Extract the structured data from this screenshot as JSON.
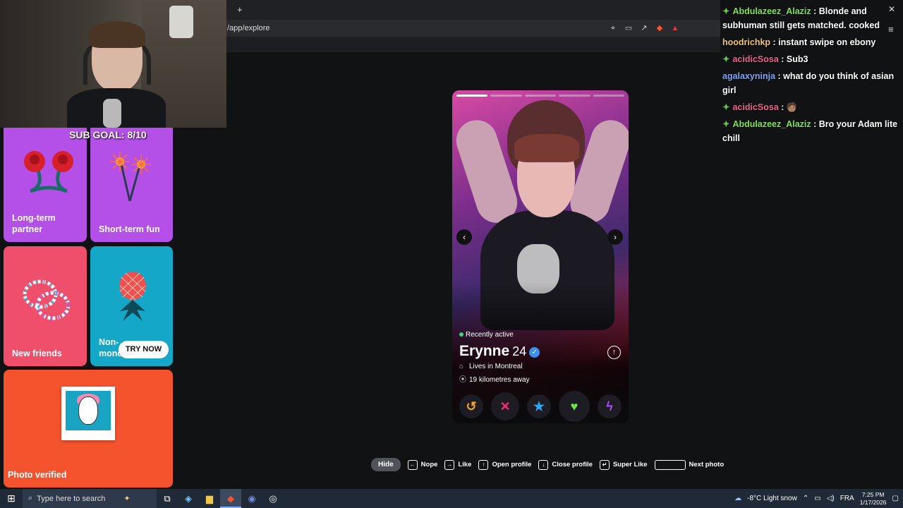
{
  "browser": {
    "new_tab_icon": "+",
    "url": "/app/explore"
  },
  "left_panel": {
    "sub_goal": "SUB GOAL: 8/10",
    "tiles": [
      {
        "label": "Long-term partner",
        "icon": "roses-icon",
        "color": "#b450e8"
      },
      {
        "label": "Short-term fun",
        "icon": "sparkler-icon",
        "color": "#b450e8"
      },
      {
        "label": "New friends",
        "icon": "bracelet-icon",
        "color": "#ef4f6b"
      },
      {
        "label": "Non-monogamous",
        "icon": "pineapple-icon",
        "color": "#14a7c7"
      },
      {
        "label": "Photo verified",
        "icon": "photo-card-icon",
        "color": "#f4532d"
      }
    ],
    "try_now": "TRY NOW"
  },
  "profile": {
    "status": "Recently active",
    "name": "Erynne",
    "age": "24",
    "lives_in": "Lives in Montreal",
    "distance": "19 kilometres away",
    "photo_count": 5,
    "active_photo_index": 0
  },
  "shortcuts": {
    "hide": "Hide",
    "items": [
      {
        "label": "Nope",
        "key": "←"
      },
      {
        "label": "Like",
        "key": "→"
      },
      {
        "label": "Open profile",
        "key": "↑"
      },
      {
        "label": "Close profile",
        "key": "↓"
      },
      {
        "label": "Super Like",
        "key": "↵"
      },
      {
        "label": "Next photo",
        "key": ""
      }
    ]
  },
  "chat": {
    "messages": [
      {
        "user": "Abdulazeez_Alaziz",
        "color": "#7ee64a",
        "badge": true,
        "text": "Blonde and subhuman still gets matched. cooked"
      },
      {
        "user": "hoodrichkp",
        "color": "#f4c56a",
        "badge": false,
        "text": "instant swipe on ebony"
      },
      {
        "user": "acidicSosa",
        "color": "#f0608a",
        "badge": true,
        "text": "Sub3"
      },
      {
        "user": "agalaxyninja",
        "color": "#7aa4ff",
        "badge": false,
        "text": "what do you think of asian girl"
      },
      {
        "user": "acidicSosa",
        "color": "#f0608a",
        "badge": true,
        "text": "🧑🏽"
      },
      {
        "user": "Abdulazeez_Alaziz",
        "color": "#7ee64a",
        "badge": true,
        "text": "Bro your Adam lite chill"
      }
    ]
  },
  "taskbar": {
    "search_placeholder": "Type here to search",
    "weather": "-8°C  Light snow",
    "language": "FRA",
    "time": "7:25 PM",
    "date": "1/17/2026"
  }
}
